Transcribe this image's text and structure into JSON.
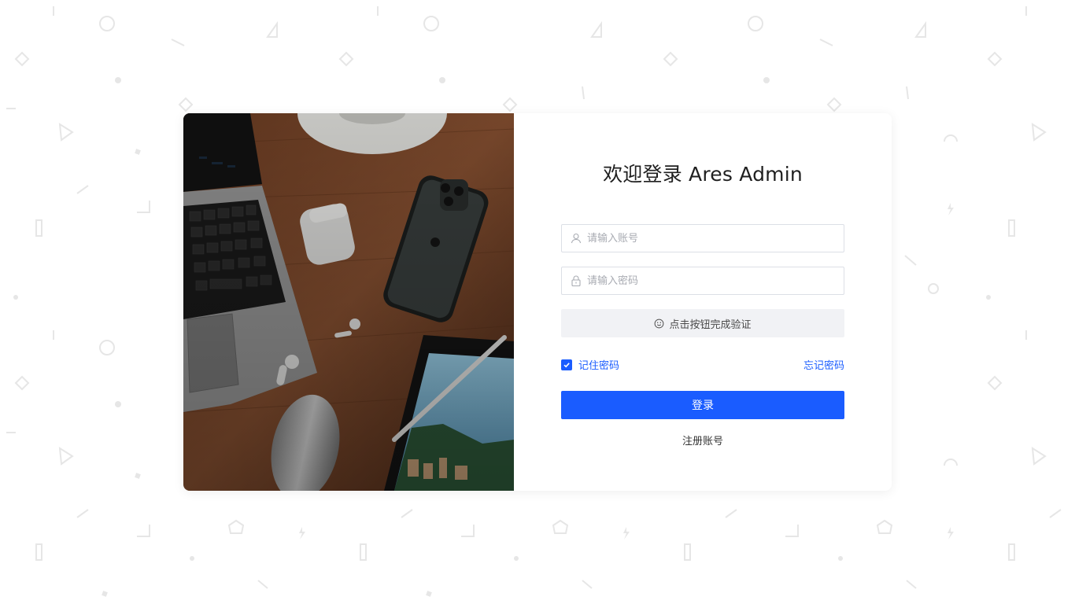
{
  "login": {
    "title": "欢迎登录 Ares Admin",
    "username_placeholder": "请输入账号",
    "password_placeholder": "请输入密码",
    "verify_label": "点击按钮完成验证",
    "remember_label": "记住密码",
    "remember_checked": true,
    "forgot_label": "忘记密码",
    "submit_label": "登录",
    "register_label": "注册账号"
  },
  "icons": {
    "username": "user-icon",
    "password": "lock-icon",
    "verify": "smile-icon",
    "checkbox": "check-icon"
  },
  "colors": {
    "primary": "#1a5cff",
    "verify_bg": "#f1f2f5",
    "input_border": "#dcdfe6",
    "placeholder": "#a8abb2"
  }
}
